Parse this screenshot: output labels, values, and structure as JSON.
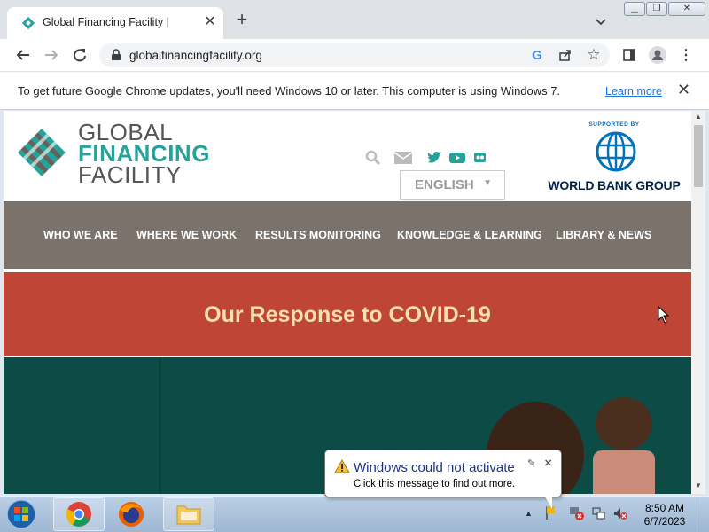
{
  "browser": {
    "tab_title": "Global Financing Facility |",
    "new_tab_label": "+",
    "url": "globalfinancingfacility.org",
    "infobar_text": "To get future Google Chrome updates, you'll need Windows 10 or later. This computer is using Windows 7.",
    "infobar_link": "Learn more"
  },
  "site": {
    "logo_line1": "GLOBAL",
    "logo_line2": "FINANCING",
    "logo_line3": "FACILITY",
    "language": "ENGLISH",
    "wb_supported": "SUPPORTED BY",
    "wb_name": "WORLD BANK GROUP",
    "nav": [
      "WHO WE ARE",
      "WHERE WE WORK",
      "RESULTS MONITORING",
      "KNOWLEDGE & LEARNING",
      "LIBRARY & NEWS"
    ],
    "banner": "Our Response to COVID-19"
  },
  "notification": {
    "title": "Windows could not activate",
    "message": "Click this message to find out more."
  },
  "taskbar": {
    "time": "8:50 AM",
    "date": "6/7/2023"
  },
  "colors": {
    "nav_bg": "#7b726b",
    "banner_bg": "#bf4537",
    "brand_teal": "#26a29a",
    "link_blue": "#1a73e8"
  }
}
